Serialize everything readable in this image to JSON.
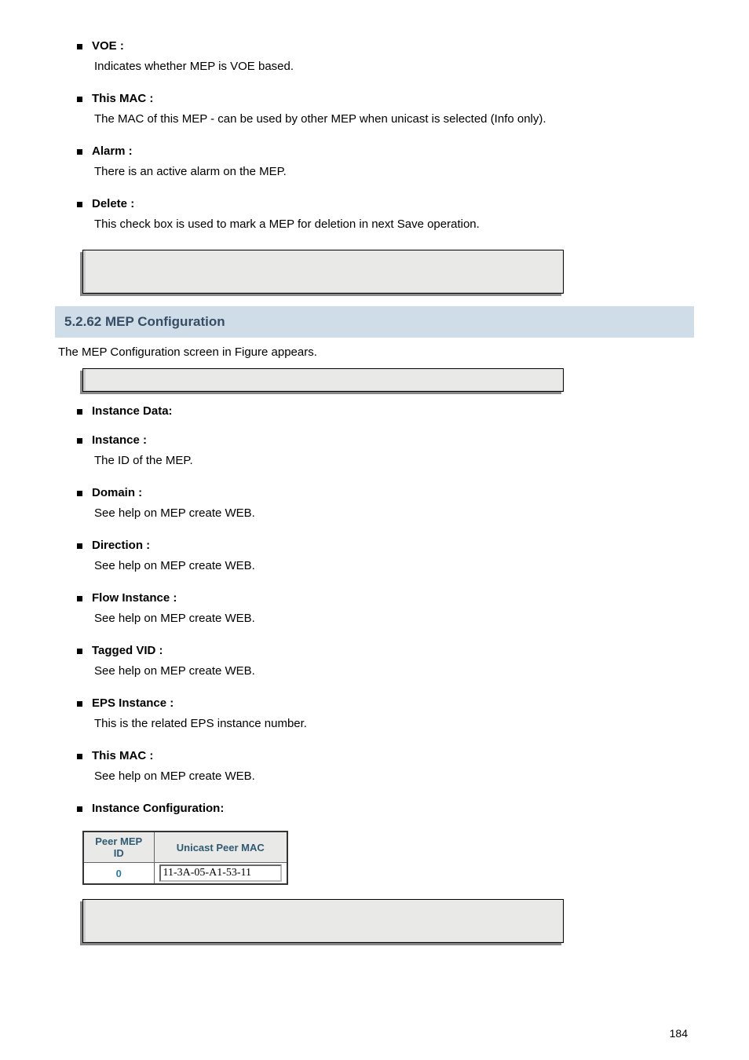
{
  "items": [
    {
      "title": "VOE :",
      "body": "Indicates whether MEP is VOE based."
    },
    {
      "title": "This MAC :",
      "body": "The MAC of this MEP - can be used by other MEP when unicast is selected (Info only)."
    },
    {
      "title": "Alarm :",
      "body": "There is an active alarm on the MEP."
    },
    {
      "title": "Delete :",
      "body": "This check box is used to mark a MEP for deletion in next Save operation."
    }
  ],
  "section_header": "5.2.62 MEP Configuration",
  "section_lead": "The MEP Configuration screen in Figure appears.",
  "instance_items": [
    {
      "title": "Instance Data:"
    },
    {
      "title": "Instance :",
      "body": "The ID of the MEP."
    },
    {
      "title": "Domain :",
      "body": "See help on MEP create WEB."
    },
    {
      "title": "Direction :",
      "body": "See help on MEP create WEB."
    },
    {
      "title": "Flow Instance :",
      "body": "See help on MEP create WEB."
    },
    {
      "title": "Tagged VID :",
      "body": "See help on MEP create WEB."
    },
    {
      "title": "EPS Instance :",
      "body": "This is the related EPS instance number."
    },
    {
      "title": "This MAC :",
      "body": "See help on MEP create WEB."
    },
    {
      "title": "Instance Configuration:"
    }
  ],
  "peer_table": {
    "col1": "Peer MEP ID",
    "col2": "Unicast Peer MAC",
    "row_id": "0",
    "row_mac": "11-3A-05-A1-53-11"
  },
  "page_number": "184"
}
